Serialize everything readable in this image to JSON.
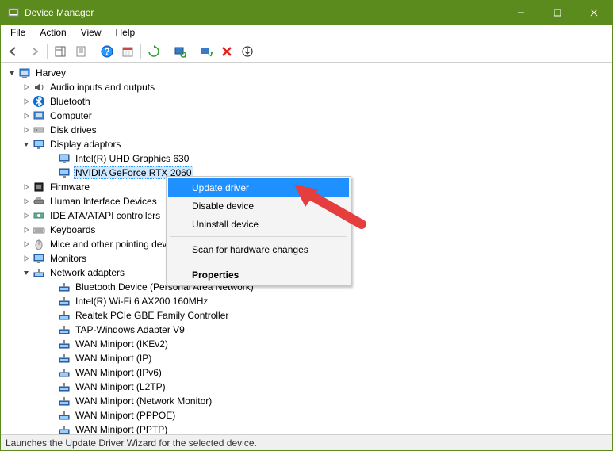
{
  "title": "Device Manager",
  "menus": {
    "file": "File",
    "action": "Action",
    "view": "View",
    "help": "Help"
  },
  "root": "Harvey",
  "cat": {
    "audio": "Audio inputs and outputs",
    "bluetooth": "Bluetooth",
    "computer": "Computer",
    "disk": "Disk drives",
    "display": "Display adaptors",
    "intel_gpu": "Intel(R) UHD Graphics 630",
    "nvidia_gpu": "NVIDIA GeForce RTX 2060",
    "firmware": "Firmware",
    "hid": "Human Interface Devices",
    "ide": "IDE ATA/ATAPI controllers",
    "keyboards": "Keyboards",
    "mice": "Mice and other pointing devices",
    "monitors": "Monitors",
    "network": "Network adapters",
    "bt_pan": "Bluetooth Device (Personal Area Network)",
    "wifi": "Intel(R) Wi-Fi 6 AX200 160MHz",
    "realtek": "Realtek PCIe GBE Family Controller",
    "tap": "TAP-Windows Adapter V9",
    "wan_ikev2": "WAN Miniport (IKEv2)",
    "wan_ip": "WAN Miniport (IP)",
    "wan_ipv6": "WAN Miniport (IPv6)",
    "wan_l2tp": "WAN Miniport (L2TP)",
    "wan_netmon": "WAN Miniport (Network Monitor)",
    "wan_pppoe": "WAN Miniport (PPPOE)",
    "wan_pptp": "WAN Miniport (PPTP)"
  },
  "ctx": {
    "update": "Update driver",
    "disable": "Disable device",
    "uninstall": "Uninstall device",
    "scan": "Scan for hardware changes",
    "properties": "Properties"
  },
  "status": "Launches the Update Driver Wizard for the selected device."
}
